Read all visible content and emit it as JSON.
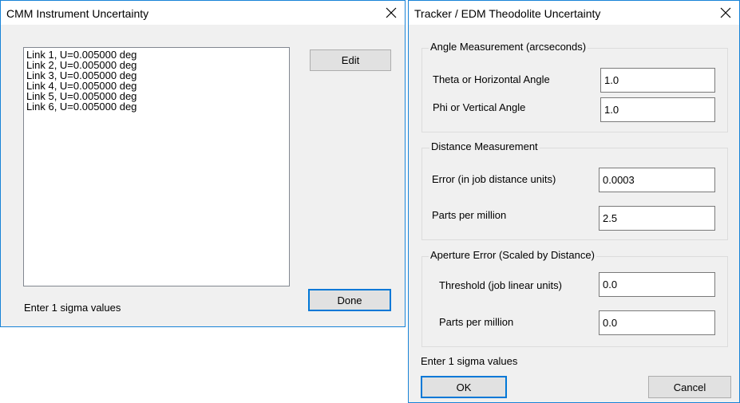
{
  "cmm_dialog": {
    "title": "CMM Instrument Uncertainty",
    "list_items": [
      "Link 1, U=0.005000 deg",
      "Link 2, U=0.005000 deg",
      "Link 3, U=0.005000 deg",
      "Link 4, U=0.005000 deg",
      "Link 5, U=0.005000 deg",
      "Link 6, U=0.005000 deg"
    ],
    "edit_label": "Edit",
    "done_label": "Done",
    "hint": "Enter 1 sigma values"
  },
  "tracker_dialog": {
    "title": "Tracker / EDM Theodolite Uncertainty",
    "angle_group": {
      "title": "Angle Measurement (arcseconds)",
      "theta_label": "Theta or Horizontal Angle",
      "theta_value": "1.0",
      "phi_label": "Phi or Vertical Angle",
      "phi_value": "1.0"
    },
    "distance_group": {
      "title": "Distance Measurement",
      "error_label": "Error (in job distance units)",
      "error_value": "0.0003",
      "ppm_label": "Parts per million",
      "ppm_value": "2.5"
    },
    "aperture_group": {
      "title": "Aperture Error (Scaled by Distance)",
      "threshold_label": "Threshold (job linear units)",
      "threshold_value": "0.0",
      "ppm_label": "Parts per million",
      "ppm_value": "0.0"
    },
    "hint": "Enter 1 sigma values",
    "ok_label": "OK",
    "cancel_label": "Cancel"
  },
  "icons": {
    "close": "close-icon"
  },
  "colors": {
    "window_border": "#1883d7",
    "dialog_bg": "#f0f0f0",
    "default_button_border": "#0078d7"
  }
}
